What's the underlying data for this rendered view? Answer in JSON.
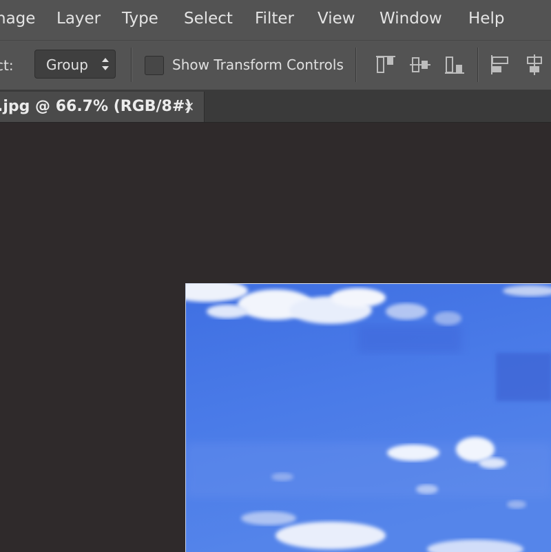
{
  "menu": {
    "items": [
      {
        "key": "image",
        "label": "nage"
      },
      {
        "key": "layer",
        "label": "Layer"
      },
      {
        "key": "type",
        "label": "Type"
      },
      {
        "key": "select",
        "label": "Select"
      },
      {
        "key": "filter",
        "label": "Filter"
      },
      {
        "key": "view",
        "label": "View"
      },
      {
        "key": "window",
        "label": "Window"
      },
      {
        "key": "help",
        "label": "Help"
      }
    ]
  },
  "options": {
    "auto_select_label": "ct:",
    "auto_select_value": "Group",
    "show_transform_label": "Show Transform Controls",
    "show_transform_checked": false
  },
  "document": {
    "tab_title": ".jpg @ 66.7% (RGB/8#)",
    "close_glyph": "×"
  },
  "colors": {
    "sky": "#4a7be6",
    "panel": "#535353",
    "workspace": "#2f2a2b"
  }
}
